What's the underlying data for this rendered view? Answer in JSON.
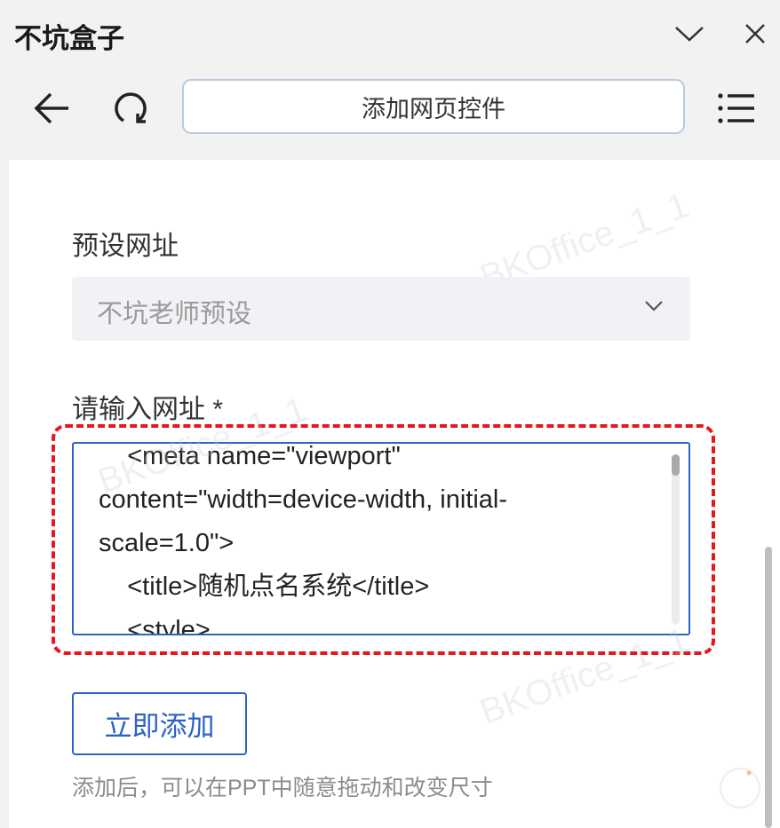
{
  "app": {
    "title": "不坑盒子"
  },
  "window": {
    "collapse_icon": "chevron-down-icon",
    "close_icon": "close-icon"
  },
  "toolbar": {
    "back_icon": "back-arrow-icon",
    "refresh_icon": "refresh-icon",
    "address_text": "添加网页控件",
    "menu_icon": "menu-icon"
  },
  "form": {
    "preset_label": "预设网址",
    "preset_selected": "不坑老师预设",
    "url_label": "请输入网址 *",
    "url_value_lines": [
      "    <meta name=\"viewport\"",
      "content=\"width=device-width, initial-",
      "scale=1.0\">",
      "    <title>随机点名系统</title>",
      "    <style>"
    ],
    "add_button": "立即添加",
    "hint": "添加后，可以在PPT中随意拖动和改变尺寸"
  },
  "watermarks": [
    "BKOffice_1_1",
    "BKOffice_1_1",
    "BKOffice_1_1"
  ],
  "colors": {
    "accent": "#2e62c7",
    "highlight_border": "#e8161b"
  }
}
